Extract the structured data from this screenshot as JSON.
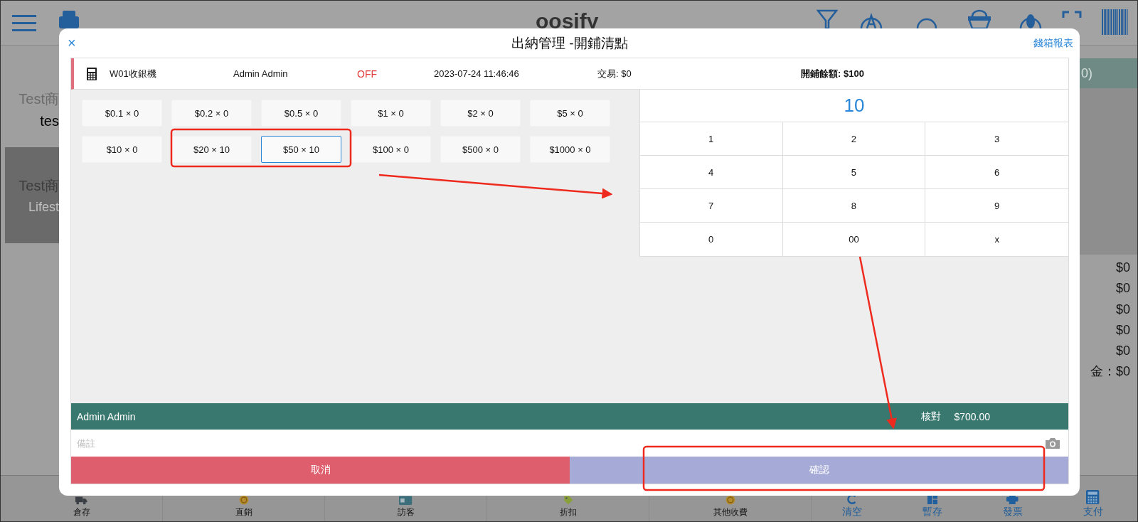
{
  "background_app": {
    "top_bar": {
      "logo": "oosify"
    },
    "left_panel": {
      "product_name": "Test商",
      "product_code": "tes",
      "card_title": "Test商",
      "card_subtitle": "Lifest"
    },
    "right_panel": {
      "header": "0)",
      "amounts": [
        "$0",
        "$0",
        "$0",
        "$0",
        "$0"
      ],
      "cash_total": "金：$0"
    },
    "bottom_bar": [
      {
        "label": "倉存",
        "kind": "truck",
        "accent": false
      },
      {
        "label": "直銷",
        "kind": "coin",
        "accent": false
      },
      {
        "label": "訪客",
        "kind": "card",
        "accent": false
      },
      {
        "label": "折扣",
        "kind": "tag",
        "accent": false
      },
      {
        "label": "其他收費",
        "kind": "coin",
        "accent": false
      },
      {
        "label": "清空",
        "kind": "clear",
        "accent": true
      },
      {
        "label": "暫存",
        "kind": "grid",
        "accent": true
      },
      {
        "label": "發票",
        "kind": "printer",
        "accent": true
      },
      {
        "label": "支付",
        "kind": "calculator",
        "accent": true
      }
    ]
  },
  "dialog": {
    "close": "×",
    "title": "出納管理 -開鋪清點",
    "report_link": "錢箱報表",
    "register": {
      "name": "W01收銀機",
      "user": "Admin Admin",
      "status": "OFF",
      "datetime": "2023-07-24 11:46:46",
      "transactions": "交易: $0",
      "opening_balance": "開鋪餘額: $100"
    },
    "denominations": [
      {
        "label": "$0.1 × 0",
        "selected": false
      },
      {
        "label": "$0.2 × 0",
        "selected": false
      },
      {
        "label": "$0.5 × 0",
        "selected": false
      },
      {
        "label": "$1 × 0",
        "selected": false
      },
      {
        "label": "$2 × 0",
        "selected": false
      },
      {
        "label": "$5 × 0",
        "selected": false
      },
      {
        "label": "$10 × 0",
        "selected": false
      },
      {
        "label": "$20 × 10",
        "selected": false
      },
      {
        "label": "$50 × 10",
        "selected": true
      },
      {
        "label": "$100 × 0",
        "selected": false
      },
      {
        "label": "$500 × 0",
        "selected": false
      },
      {
        "label": "$1000 × 0",
        "selected": false
      }
    ],
    "keypad": {
      "display": "10",
      "keys": [
        "1",
        "2",
        "3",
        "4",
        "5",
        "6",
        "7",
        "8",
        "9",
        "0",
        "00",
        "x"
      ]
    },
    "summary": {
      "user": "Admin Admin",
      "check_label": "核對",
      "check_amount": "$700.00"
    },
    "notes": {
      "placeholder": "備註"
    },
    "buttons": [
      {
        "label": "取消",
        "kind": "cancel"
      },
      {
        "label": "確認",
        "kind": "confirm"
      }
    ]
  }
}
